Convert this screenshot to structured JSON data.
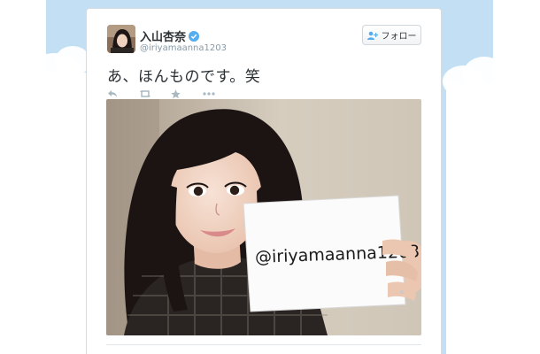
{
  "tweet": {
    "display_name": "入山杏奈",
    "handle": "@iriyamaanna1203",
    "text": "あ、ほんものです。笑",
    "follow_label": "フォロー",
    "photo_sign_text": "@iriyamaanna1203"
  },
  "icons": {
    "verified": "verified-badge-icon",
    "follow": "add-user-icon",
    "reply": "reply-icon",
    "retweet": "retweet-icon",
    "favorite": "star-icon",
    "more": "more-icon"
  },
  "colors": {
    "background_sky": "#c2dff3",
    "verified_blue": "#55acee",
    "text_primary": "#292f33",
    "text_secondary": "#8899a6",
    "action_gray": "#aab8c2"
  }
}
